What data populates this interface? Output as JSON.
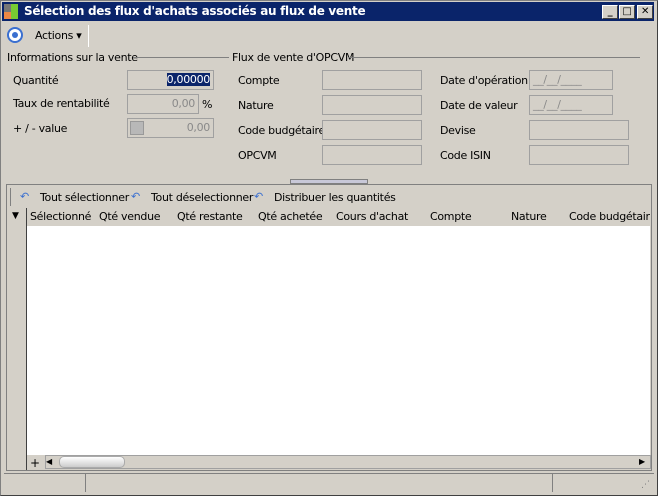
{
  "window": {
    "title": "Sélection des flux d'achats associés au flux de vente",
    "min": "_",
    "max": "□",
    "close": "✕"
  },
  "toolbar": {
    "actions": "Actions"
  },
  "vente": {
    "group": "Informations sur la vente",
    "quantite_label": "Quantité",
    "quantite": "0,00000",
    "taux_label": "Taux de rentabilité",
    "taux": "0,00",
    "percent": "%",
    "pv_label": "+ / - value",
    "pv": "0,00"
  },
  "opcvm": {
    "group": "Flux de vente d'OPCVM",
    "compte": "Compte",
    "nature": "Nature",
    "code_budgetaire": "Code budgétaire",
    "opcvm": "OPCVM",
    "date_operation": "Date d'opération",
    "date_operation_value": "__/__/____",
    "date_valeur": "Date de valeur",
    "date_valeur_value": "__/__/____",
    "devise": "Devise",
    "code_isin": "Code ISIN"
  },
  "grid": {
    "actions": [
      "Tout sélectionner",
      "Tout déselectionner",
      "Distribuer les quantités"
    ],
    "columns": [
      "Sélectionné",
      "Qté vendue",
      "Qté restante",
      "Qté achetée",
      "Cours d'achat",
      "Compte",
      "Nature",
      "Code budgétaire"
    ],
    "add": "+"
  }
}
